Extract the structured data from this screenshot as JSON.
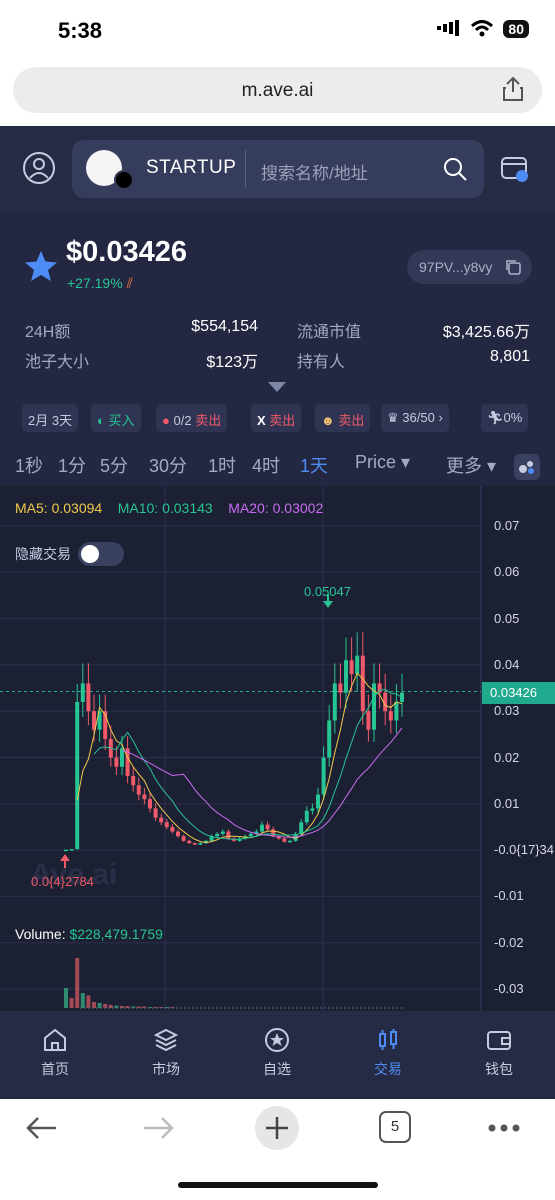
{
  "status": {
    "time": "5:38",
    "battery": "80"
  },
  "browser": {
    "url": "m.ave.ai",
    "tab_count": "5"
  },
  "header": {
    "token_name": "STARTUP",
    "search_placeholder": "搜索名称/地址"
  },
  "token": {
    "price": "$0.03426",
    "change": "+27.19%",
    "address": "97PV...y8vy",
    "stats": {
      "volume_24h_label": "24H额",
      "volume_24h_value": "$554,154",
      "mcap_label": "流通市值",
      "mcap_value": "$3,425.66万",
      "pool_label": "池子大小",
      "pool_value": "$123万",
      "holders_label": "持有人",
      "holders_value": "8,801"
    },
    "tags": {
      "age": "2月 3天",
      "buy": "买入",
      "sell_count": "0/2",
      "sell1": "卖出",
      "sell2": "卖出",
      "sell3": "卖出",
      "rank": "36/50",
      "run": "0%"
    }
  },
  "timeframes": [
    "1秒",
    "1分",
    "5分",
    "30分",
    "1时",
    "4时",
    "1天"
  ],
  "active_timeframe": "1天",
  "price_dropdown": "Price",
  "more_dropdown": "更多",
  "chart_labels": {
    "ma5": "MA5: 0.03094",
    "ma10": "MA10: 0.03143",
    "ma20": "MA20: 0.03002",
    "hide_trades": "隐藏交易",
    "current_price": "0.03426",
    "high_marker": "0.05047",
    "low_marker": "0.0{4}2784",
    "volume_label": "Volume:",
    "volume_value": "$228,479.1759",
    "watermark": "Ave.ai"
  },
  "chart_data": {
    "type": "candlestick",
    "y_ticks": [
      "0.07",
      "0.06",
      "0.05",
      "0.04",
      "0.03",
      "0.02",
      "0.01",
      "-0.0{17}34",
      "-0.01",
      "-0.02",
      "-0.03"
    ],
    "ylim": [
      -0.03,
      0.07
    ],
    "indicators": [
      "MA5",
      "MA10",
      "MA20"
    ],
    "last_price": 0.03426,
    "high": 0.05047,
    "low": 2.784e-05
  },
  "bottom_nav": [
    "首页",
    "市场",
    "自选",
    "交易",
    "钱包"
  ],
  "active_nav": "交易",
  "colors": {
    "up": "#27c593",
    "down": "#f05a6a",
    "accent": "#4e8cf5",
    "ma5": "#f2c94c",
    "ma10": "#27c593",
    "ma20": "#c86bf0"
  }
}
